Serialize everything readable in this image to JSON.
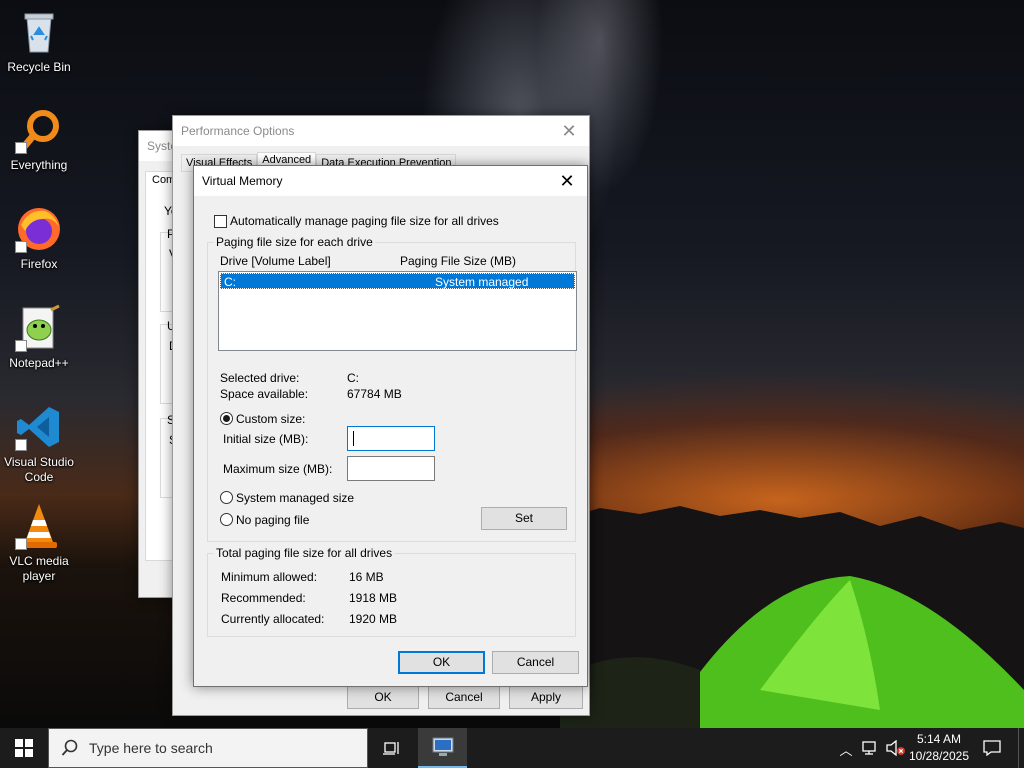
{
  "desktop": {
    "icons": [
      {
        "label": "Recycle Bin",
        "icon": "recycle-bin-icon"
      },
      {
        "label": "Everything",
        "icon": "everything-search-icon"
      },
      {
        "label": "Firefox",
        "icon": "firefox-icon"
      },
      {
        "label": "Notepad++",
        "icon": "notepad-plus-plus-icon"
      },
      {
        "label": "Visual Studio Code",
        "icon": "vscode-icon"
      },
      {
        "label": "VLC media player",
        "icon": "vlc-icon"
      }
    ]
  },
  "system_props": {
    "title": "Syste",
    "tab": "Com",
    "frag_y": "Yo",
    "frag_p": "P",
    "frag_v": "V",
    "frag_u": "U",
    "frag_d": "D",
    "frag_s": "S",
    "frag_s2": "S"
  },
  "perf_options": {
    "title": "Performance Options",
    "tabs": [
      "Visual Effects",
      "Advanced",
      "Data Execution Prevention"
    ],
    "ok": "OK",
    "cancel": "Cancel",
    "apply": "Apply"
  },
  "vm": {
    "title": "Virtual Memory",
    "auto_manage": "Automatically manage paging file size for all drives",
    "auto_manage_checked": false,
    "group_each": "Paging file size for each drive",
    "col_drive": "Drive  [Volume Label]",
    "col_size": "Paging File Size (MB)",
    "rows": [
      {
        "drive": "C:",
        "size": "System managed"
      }
    ],
    "selected_drive_label": "Selected drive:",
    "selected_drive": "C:",
    "space_label": "Space available:",
    "space": "67784 MB",
    "custom_size": "Custom size:",
    "initial_label": "Initial size (MB):",
    "initial_value": "",
    "max_label": "Maximum size (MB):",
    "max_value": "",
    "system_managed": "System managed size",
    "no_paging": "No paging file",
    "set": "Set",
    "group_total": "Total paging file size for all drives",
    "min_label": "Minimum allowed:",
    "min_value": "16 MB",
    "rec_label": "Recommended:",
    "rec_value": "1918 MB",
    "cur_label": "Currently allocated:",
    "cur_value": "1920 MB",
    "ok": "OK",
    "cancel": "Cancel",
    "selected_option": "custom"
  },
  "taskbar": {
    "search_placeholder": "Type here to search",
    "time": "5:14 AM",
    "date": "10/28/2025"
  },
  "colors": {
    "accent": "#0078d7",
    "selection": "#0078d7",
    "taskbar": "#1c1c1c"
  }
}
